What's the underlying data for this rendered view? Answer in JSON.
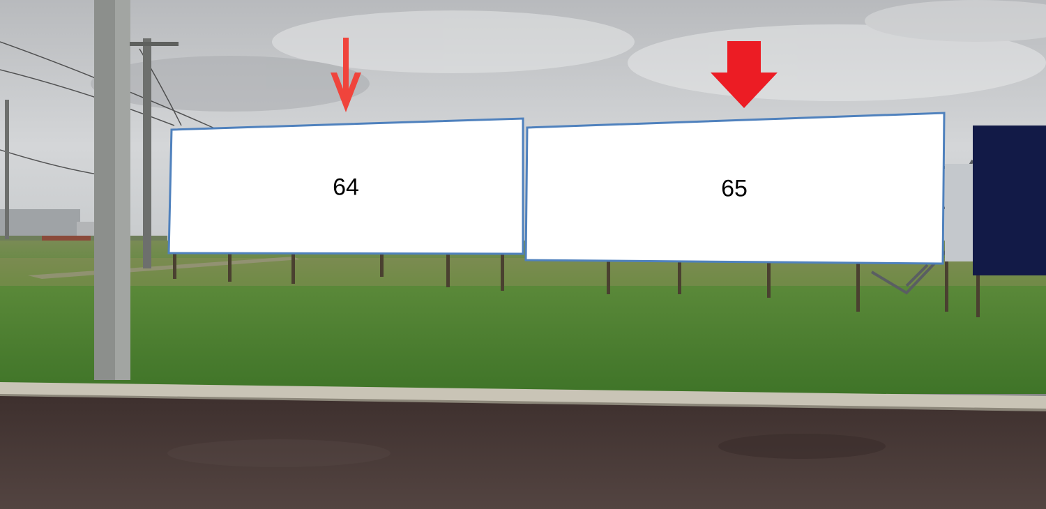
{
  "billboards": [
    {
      "label": "64",
      "arrow_style": "thin-arrow",
      "arrow_color": "#F0443C"
    },
    {
      "label": "65",
      "arrow_style": "block-arrow",
      "arrow_color": "#EC1C24"
    }
  ],
  "colors": {
    "board_fill": "#FFFFFF",
    "board_border": "#4F81BD",
    "dark_panel": "#121A47",
    "grass": "#4E7F30",
    "asphalt": "#4A3A38",
    "sky": "#C9CBCD"
  }
}
